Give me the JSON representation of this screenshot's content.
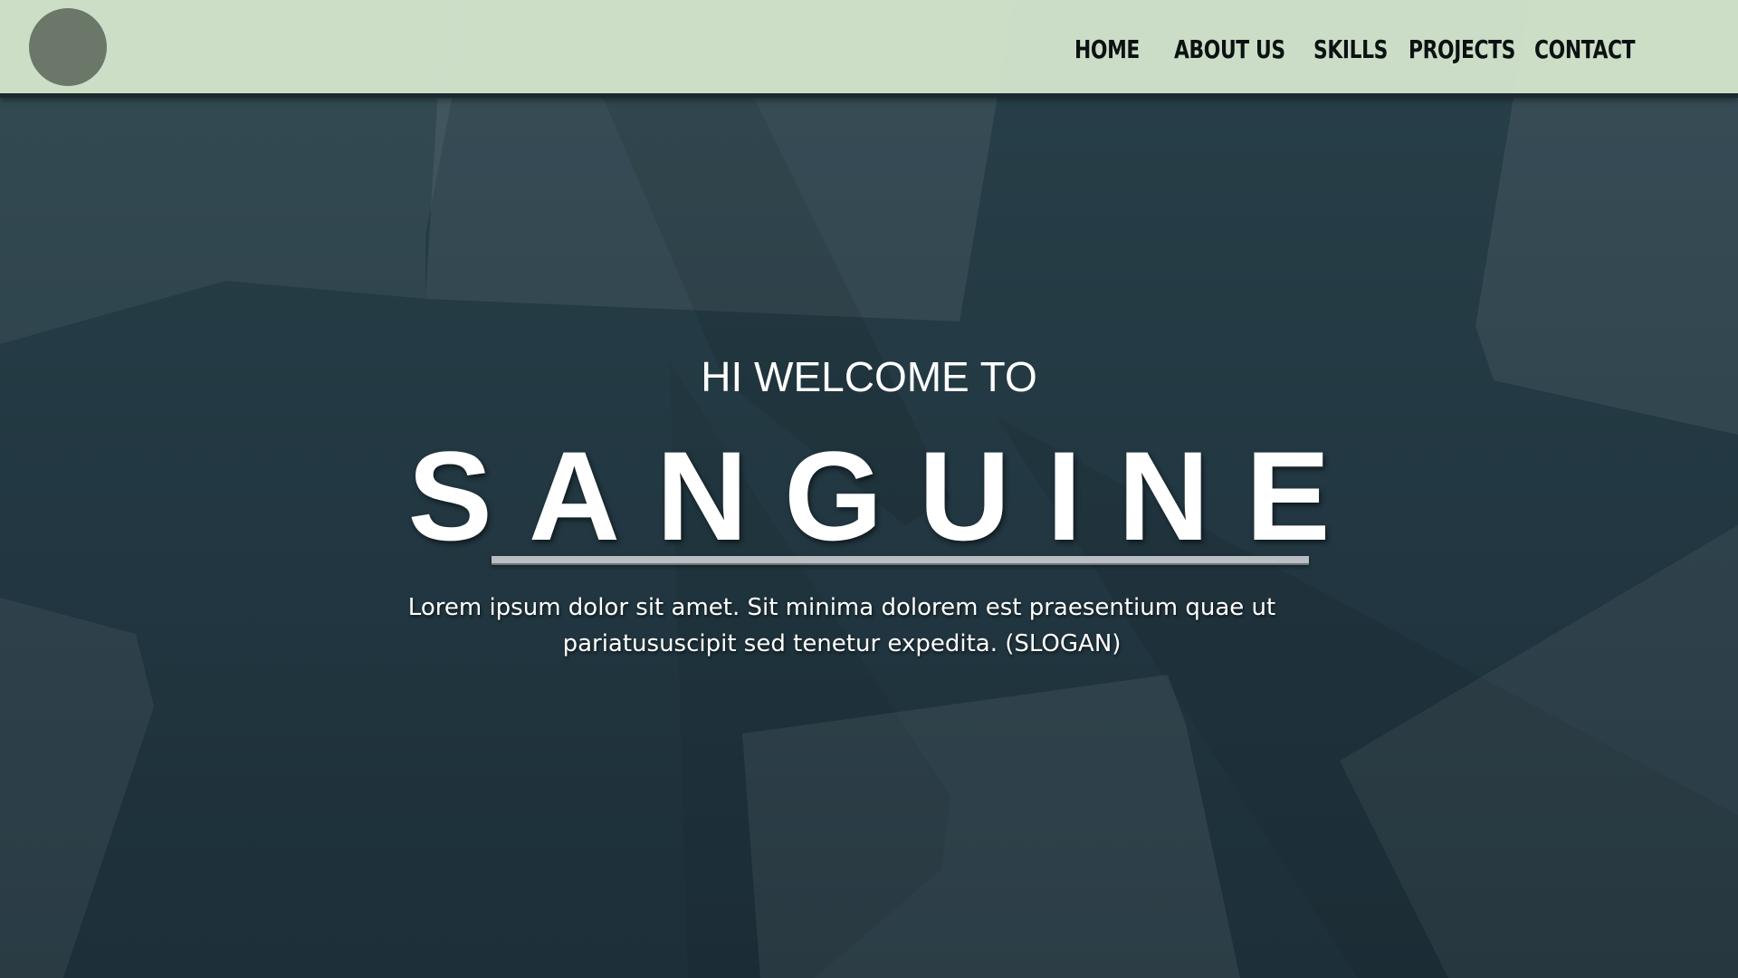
{
  "header": {
    "logo_icon": "circle-logo",
    "nav": [
      {
        "label": "HOME"
      },
      {
        "label": "ABOUT US"
      },
      {
        "label": "SKILLS"
      },
      {
        "label": "PROJECTS"
      },
      {
        "label": "CONTACT"
      }
    ]
  },
  "hero": {
    "welcome": "HI WELCOME TO",
    "title": "SANGUINE",
    "slogan_line1": "Lorem ipsum dolor sit amet. Sit minima dolorem est praesentium quae ut",
    "slogan_line2": "pariatususcipit sed tenetur expedita. (SLOGAN)"
  },
  "colors": {
    "header_bg": "#d3e4cc",
    "page_bg": "#253a42",
    "logo": "#6b7768",
    "text": "#ffffff",
    "nav_text": "#0b1212"
  }
}
